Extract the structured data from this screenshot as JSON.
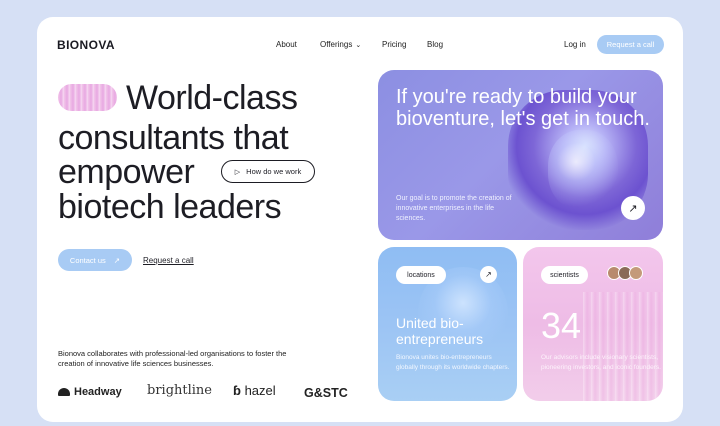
{
  "brand": {
    "name": "BIONOVA"
  },
  "nav": {
    "items": [
      {
        "label": "About"
      },
      {
        "label": "Offerings"
      },
      {
        "label": "Pricing"
      },
      {
        "label": "Blog"
      }
    ],
    "login": "Log in",
    "request_call": "Request a call"
  },
  "hero": {
    "headline": [
      "World-class",
      "consultants that",
      "empower",
      "biotech leaders"
    ],
    "how_button": "How do we work",
    "contact_button": "Contact us",
    "request_link": "Request a call",
    "collab_text": "Bionova collaborates with professional-led organisations to foster the creation of innovative life sciences businesses."
  },
  "partners": [
    "Headway",
    "brightline",
    "hazel",
    "G&STC"
  ],
  "cta_card": {
    "title": "If you're ready to build your bioventure, let's get in touch.",
    "description": "Our goal is to promote the creation of innovative enterprises in the life sciences."
  },
  "locations_card": {
    "tag": "locations",
    "title": "United bio-entrepreneurs",
    "description": "Bionova unites bio-entrepreneurs globally through its worldwide chapters."
  },
  "scientists_card": {
    "tag": "scientists",
    "number": "34",
    "description": "Our advisors include visionary scientists, pioneering investors, and iconic founders."
  },
  "icons": {
    "arrow": "arrow-up-right-icon",
    "play": "play-icon",
    "chevron": "chevron-down-icon"
  },
  "colors": {
    "background": "#d6e0f5",
    "button_blue": "#a8cbf4",
    "purple_card": "#8c8fe2",
    "blue_card": "#8fbdf3",
    "pink_card": "#f3c6ec"
  }
}
